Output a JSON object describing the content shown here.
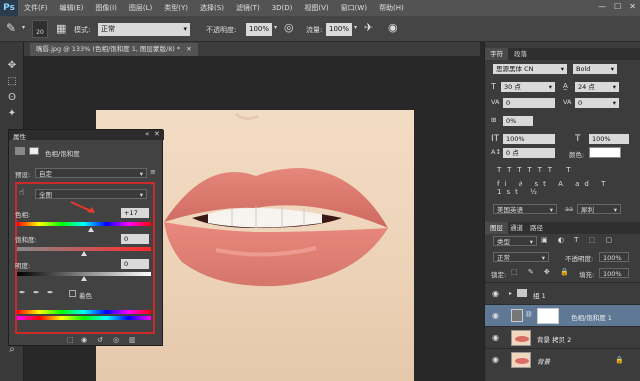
{
  "menubar": {
    "logo": "Ps",
    "items": [
      "文件(F)",
      "编辑(E)",
      "图像(I)",
      "图层(L)",
      "类型(Y)",
      "选择(S)",
      "滤镜(T)",
      "3D(D)",
      "视图(V)",
      "窗口(W)",
      "帮助(H)"
    ],
    "window_buttons": [
      "—",
      "☐",
      "✕"
    ]
  },
  "options": {
    "brush_size": "20",
    "mode_label": "模式:",
    "mode_value": "正常",
    "opacity_label": "不透明度:",
    "opacity_value": "100%",
    "flow_label": "流量:",
    "flow_value": "100%"
  },
  "document": {
    "tab_title": "嘴唇.jpg @ 133% (色相/饱和度 1, 图层蒙版/8) *",
    "tab_close": "✕"
  },
  "properties": {
    "title": "属性",
    "header": "色相/饱和度",
    "preset_label": "预设:",
    "preset_value": "自定",
    "channel_value": "全图",
    "hue_label": "色相:",
    "hue_value": "+17",
    "hue_level": 0.55,
    "saturation_label": "饱和度:",
    "saturation_value": "0",
    "lightness_label": "明度:",
    "lightness_value": "0",
    "colorize_label": "着色"
  },
  "character": {
    "tabs": [
      "字符",
      "段落"
    ],
    "font_family": "思源黑体 CN",
    "font_style": "Bold",
    "font_size": "30 点",
    "leading": "24 点",
    "kerning": "0",
    "tracking": "0",
    "scale_label": "0%",
    "vertical_scale": "100%",
    "horizontal_scale": "100%",
    "baseline": "0 点",
    "color_label": "颜色:",
    "language": "美国英语",
    "aa_label": "aa",
    "aa_value": "犀利",
    "color": "#ffffff"
  },
  "layers": {
    "tabs": [
      "图层",
      "通道",
      "路径"
    ],
    "filter_label": "类型",
    "blend_mode": "正常",
    "opacity_label": "不透明度:",
    "opacity_value": "100%",
    "lock_label": "锁定:",
    "fill_label": "填充:",
    "fill_value": "100%",
    "items": [
      {
        "name": "组 1",
        "kind": "group"
      },
      {
        "name": "色相/饱和度 1",
        "kind": "adjustment",
        "selected": true
      },
      {
        "name": "背景 拷贝 2",
        "kind": "image"
      },
      {
        "name": "背景",
        "kind": "image"
      }
    ]
  },
  "colors": {
    "accent_red": "#cc2a2a",
    "selection_blue": "#5f7895",
    "lip": "#e07b70"
  }
}
